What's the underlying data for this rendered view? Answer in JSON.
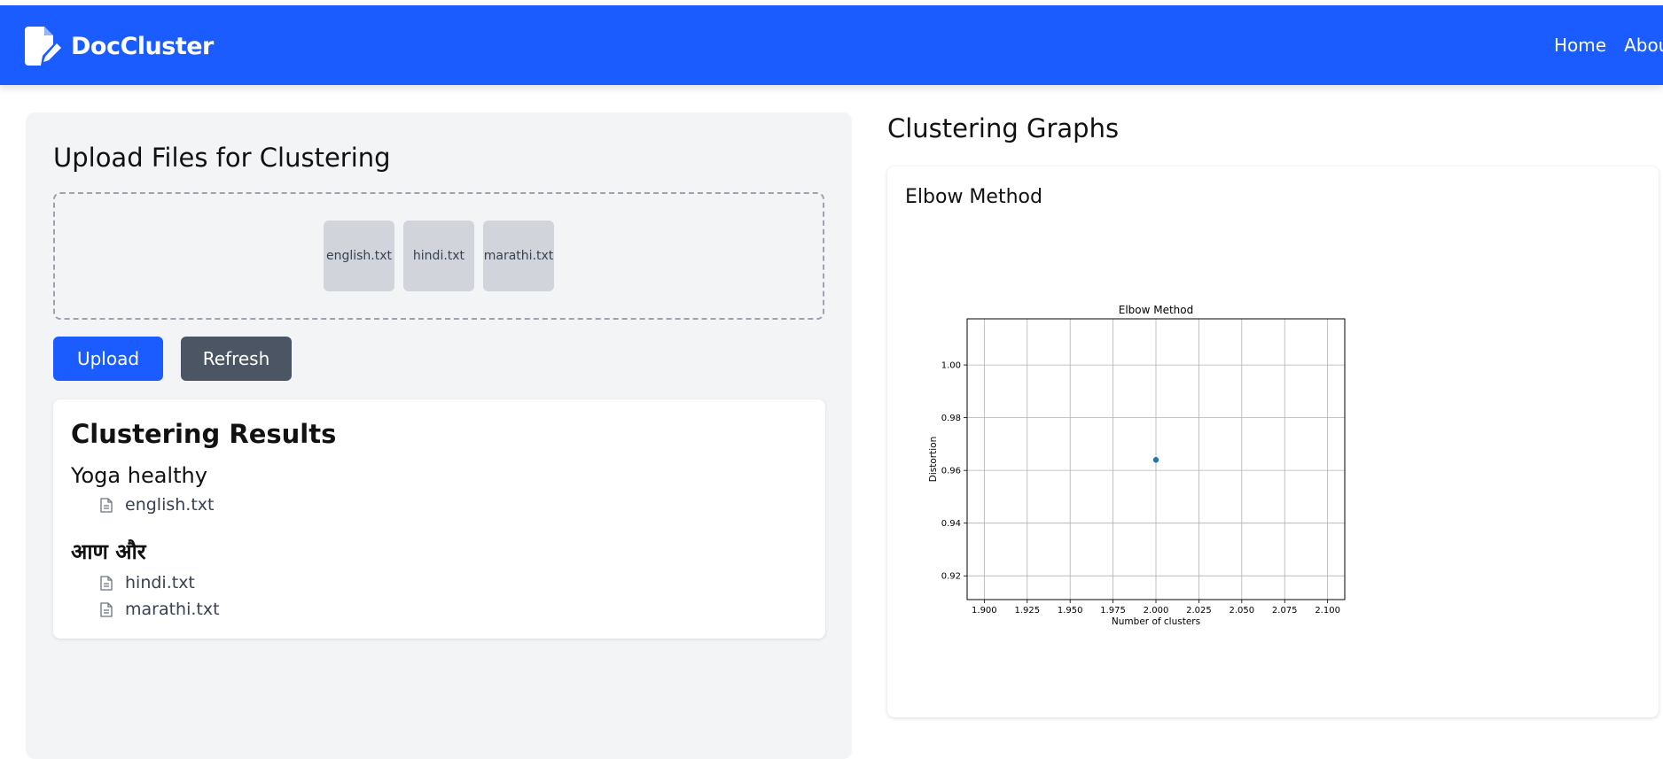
{
  "navbar": {
    "brand": "DocCluster",
    "links": [
      "Home",
      "About"
    ],
    "color": "#1a5cff"
  },
  "upload": {
    "title": "Upload Files for Clustering",
    "files": [
      "english.txt",
      "hindi.txt",
      "marathi.txt"
    ],
    "upload_label": "Upload",
    "refresh_label": "Refresh"
  },
  "results": {
    "title": "Clustering Results",
    "clusters": [
      {
        "title": "Yoga healthy",
        "files": [
          "english.txt"
        ]
      },
      {
        "title": "आण और",
        "files": [
          "hindi.txt",
          "marathi.txt"
        ]
      }
    ]
  },
  "graphs": {
    "title": "Clustering Graphs",
    "card_title": "Elbow Method"
  },
  "chart_data": {
    "type": "scatter",
    "title": "Elbow Method",
    "xlabel": "Number of clusters",
    "ylabel": "Distortion",
    "x": [
      2.0
    ],
    "y": [
      0.964
    ],
    "xlim": [
      1.89,
      2.11
    ],
    "ylim": [
      0.911,
      1.0175
    ],
    "xticks": [
      1.9,
      1.925,
      1.95,
      1.975,
      2.0,
      2.025,
      2.05,
      2.075,
      2.1
    ],
    "xtick_labels": [
      "1.900",
      "1.925",
      "1.950",
      "1.975",
      "2.000",
      "2.025",
      "2.050",
      "2.075",
      "2.100"
    ],
    "yticks": [
      0.92,
      0.94,
      0.96,
      0.98,
      1.0
    ],
    "ytick_labels": [
      "0.92",
      "0.94",
      "0.96",
      "0.98",
      "1.00"
    ],
    "grid": true,
    "point_color": "#1f77b4"
  }
}
